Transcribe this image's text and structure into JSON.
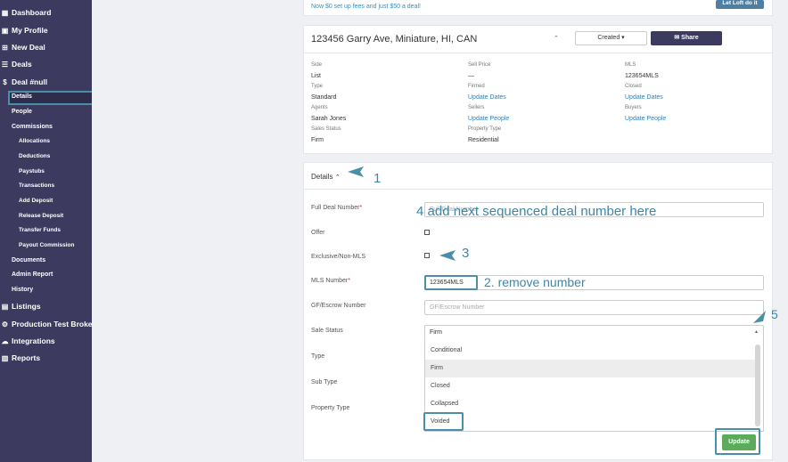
{
  "sidebar": {
    "top_items": [
      {
        "label": "Dashboard",
        "icon": "dashboard-icon"
      },
      {
        "label": "My Profile",
        "icon": "user-icon"
      },
      {
        "label": "New Deal",
        "icon": "plus-icon"
      },
      {
        "label": "Deals",
        "icon": "list-icon"
      },
      {
        "label": "Deal #null",
        "icon": "dollar-icon"
      }
    ],
    "deal_sub": {
      "details": "Details",
      "people": "People",
      "commissions": "Commissions"
    },
    "commission_items": [
      "Allocations",
      "Deductions",
      "Paystubs",
      "Transactions",
      "Add Deposit",
      "Release Deposit",
      "Transfer Funds",
      "Payout Commission"
    ],
    "deal_sub2": [
      "Documents",
      "Admin Report",
      "History"
    ],
    "bottom_items": [
      {
        "label": "Listings",
        "icon": "listings-icon"
      },
      {
        "label": "Production Test Broke",
        "icon": "gear-icon"
      },
      {
        "label": "Integrations",
        "icon": "cloud-icon"
      },
      {
        "label": "Reports",
        "icon": "chart-icon"
      }
    ]
  },
  "banner": {
    "text": "Now $0 set up fees and just $50 a deal!",
    "button": "Let Loft do it"
  },
  "deal_header": {
    "address": "123456 Garry Ave, Miniature, HI, CAN",
    "created_label": "Created",
    "share_label": "Share"
  },
  "summary": {
    "side_label": "Side",
    "side_value": "List",
    "type_label": "Type",
    "type_value": "Standard",
    "agents_label": "Agents",
    "agents_value": "Sarah Jones",
    "sales_status_label": "Sales Status",
    "sales_status_value": "Firm",
    "sell_price_label": "Sell Price",
    "sell_price_value": "—",
    "firmed_label": "Firmed",
    "firmed_value": "Update Dates",
    "sellers_label": "Sellers",
    "sellers_value": "Update People",
    "property_type_label": "Property Type",
    "property_type_value": "Residential",
    "mls_label": "MLS",
    "mls_value": "123654MLS",
    "closed_label": "Closed",
    "closed_value": "Update Dates",
    "buyers_label": "Buyers",
    "buyers_value": "Update People"
  },
  "details_form": {
    "title": "Details",
    "full_deal_number_label": "Full Deal Number",
    "full_deal_number_placeholder": "Full Deal Number",
    "offer_label": "Offer",
    "exclusive_label": "Exclusive/Non-MLS",
    "mls_number_label": "MLS Number",
    "mls_number_value": "123654MLS",
    "gf_escrow_label": "GF/Escrow Number",
    "gf_escrow_placeholder": "GF/Escrow Number",
    "sale_status_label": "Sale Status",
    "sale_status_value": "Firm",
    "type_label": "Type",
    "sub_type_label": "Sub Type",
    "property_type_label": "Property Type",
    "sale_status_options": [
      "Conditional",
      "Firm",
      "Closed",
      "Collapsed",
      "Voided"
    ],
    "update_button": "Update"
  },
  "annotations": {
    "a1": "1",
    "a2": "2. remove number",
    "a3": "3",
    "a4": "4  add next sequenced deal number here",
    "a5": "5"
  },
  "colors": {
    "sidebar_bg": "#3c3a5f",
    "annotation": "#4a8fa8",
    "link": "#2f7fb8",
    "update_green": "#5cab5c"
  }
}
